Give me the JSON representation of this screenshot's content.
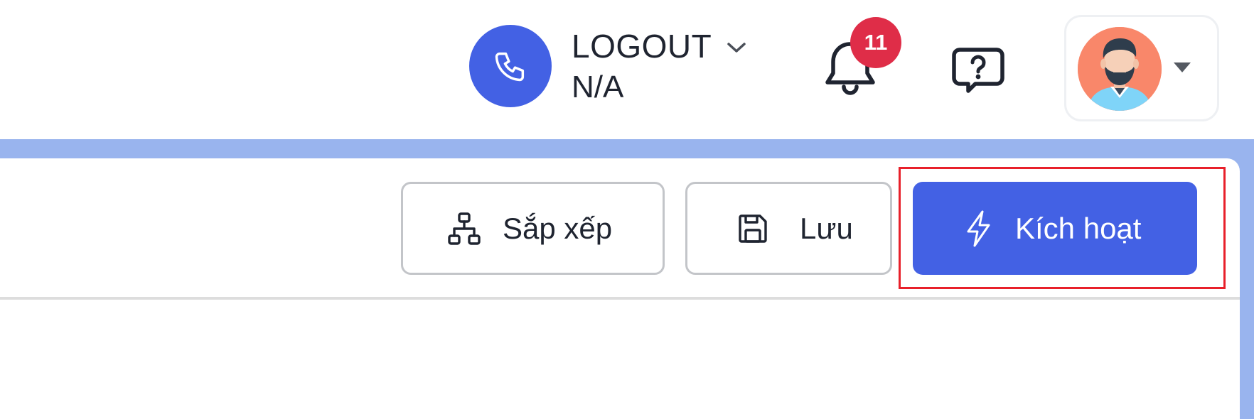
{
  "header": {
    "call_status": {
      "label": "LOGOUT",
      "sub_label": "N/A",
      "icon": "phone-icon",
      "circle_color": "#4361e4"
    },
    "notifications": {
      "icon": "bell-icon",
      "count": "11",
      "badge_color": "#df2d48"
    },
    "help": {
      "icon": "help-chat-icon"
    },
    "profile": {
      "avatar": "user-avatar",
      "dropdown_icon": "caret-down-icon"
    }
  },
  "toolbar": {
    "arrange_label": "Sắp xếp",
    "arrange_icon": "sitemap-icon",
    "save_label": "Lưu",
    "save_icon": "floppy-disk-icon",
    "activate_label": "Kích hoạt",
    "activate_icon": "lightning-icon",
    "accent_color": "#4361e4"
  },
  "colors": {
    "band": "#99b4ee",
    "highlight": "#e8202a"
  }
}
